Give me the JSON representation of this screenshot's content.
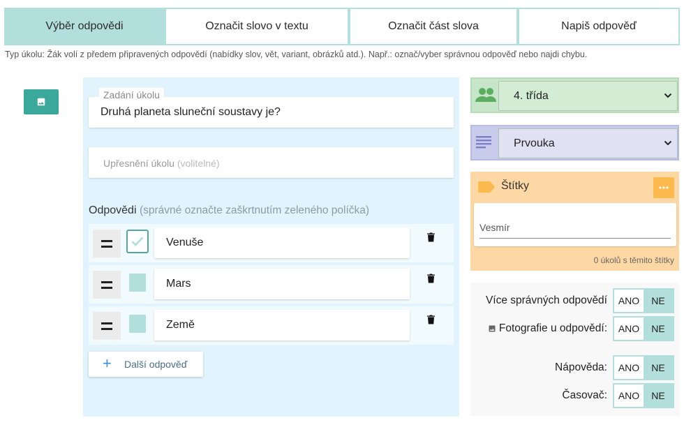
{
  "tabs": [
    {
      "label": "Výběr odpovědi",
      "active": true
    },
    {
      "label": "Označit slovo v textu",
      "active": false
    },
    {
      "label": "Označit část slova",
      "active": false
    },
    {
      "label": "Napiš odpověď",
      "active": false
    }
  ],
  "hint": "Typ úkolu: Žák volí z předem připravených odpovědí (nabídky slov, vět, variant, obrázků atd.). Např.: označ/vyber správnou odpověď nebo najdi chybu.",
  "task": {
    "label": "Zadání úkolu",
    "value": "Druhá planeta sluneční soustavy je?",
    "detail_label": "Upřesnění úkolu",
    "detail_optional": "(volitelné)"
  },
  "answers": {
    "label": "Odpovědi",
    "sublabel": "(správné označte zaškrtnutím zeleného políčka)",
    "items": [
      {
        "text": "Venuše",
        "correct": true
      },
      {
        "text": "Mars",
        "correct": false
      },
      {
        "text": "Země",
        "correct": false
      }
    ],
    "add_label": "Další odpověď"
  },
  "grade": {
    "value": "4. třída"
  },
  "subject": {
    "value": "Prvouka"
  },
  "tags": {
    "title": "Štítky",
    "value": "Vesmír",
    "count_text": "0 úkolů s těmito štítky"
  },
  "settings": [
    {
      "label": "Více správných odpovědí",
      "yes": "ANO",
      "no": "NE",
      "selected": "NE"
    },
    {
      "label": "Fotografie u odpovědí:",
      "yes": "ANO",
      "no": "NE",
      "selected": "NE"
    },
    {
      "label": "Nápověda:",
      "yes": "ANO",
      "no": "NE",
      "selected": "NE"
    },
    {
      "label": "Časovač:",
      "yes": "ANO",
      "no": "NE",
      "selected": "NE"
    }
  ],
  "colors": {
    "accent": "#b2dfdb",
    "image_button": "#3aa99b",
    "panel": "#e1f4fd",
    "grade_bg": "#c7e6c9",
    "subject_bg": "#c9cbea",
    "tags_bg": "#fdd8a4",
    "tags_button": "#fbb94e"
  }
}
